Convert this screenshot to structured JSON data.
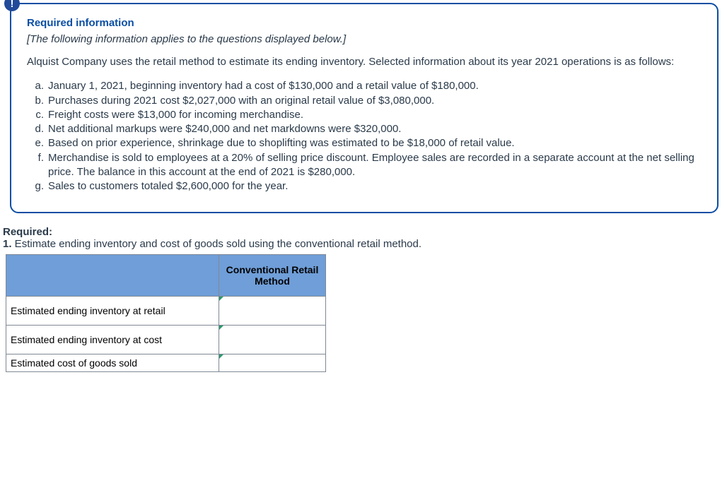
{
  "info_box": {
    "heading": "Required information",
    "note": "[The following information applies to the questions displayed below.]",
    "intro": "Alquist Company uses the retail method to estimate its ending inventory. Selected information about its year 2021 operations is as follows:",
    "items": [
      {
        "marker": "a.",
        "text": "January 1, 2021, beginning inventory had a cost of $130,000 and a retail value of $180,000."
      },
      {
        "marker": "b.",
        "text": "Purchases during 2021 cost $2,027,000 with an original retail value of $3,080,000."
      },
      {
        "marker": "c.",
        "text": "Freight costs were $13,000 for incoming merchandise."
      },
      {
        "marker": "d.",
        "text": "Net additional markups were $240,000 and net markdowns were $320,000."
      },
      {
        "marker": "e.",
        "text": "Based on prior experience, shrinkage due to shoplifting was estimated to be $18,000 of retail value."
      },
      {
        "marker": "f.",
        "text": "Merchandise is sold to employees at a 20% of selling price discount. Employee sales are recorded in a separate account at the net selling price. The balance in this account at the end of 2021 is $280,000."
      },
      {
        "marker": "g.",
        "text": "Sales to customers totaled $2,600,000 for the year."
      }
    ]
  },
  "required": {
    "label": "Required:",
    "q1_num": "1.",
    "q1_text": " Estimate ending inventory and cost of goods sold using the conventional retail method."
  },
  "table": {
    "col_header": "Conventional Retail Method",
    "rows": [
      {
        "label": "Estimated ending inventory at retail",
        "value": ""
      },
      {
        "label": "Estimated ending inventory at cost",
        "value": ""
      },
      {
        "label": "Estimated cost of goods sold",
        "value": ""
      }
    ]
  },
  "badge_glyph": "!"
}
